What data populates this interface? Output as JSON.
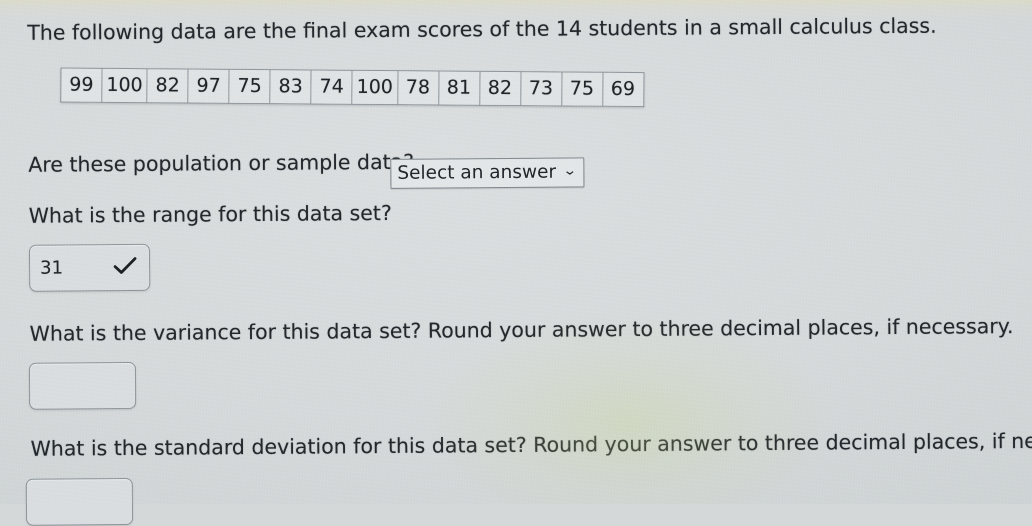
{
  "problem": {
    "intro": "The following data are the final exam scores of the 14 students in a small calculus class.",
    "scores": [
      99,
      100,
      82,
      97,
      75,
      83,
      74,
      100,
      78,
      81,
      82,
      73,
      75,
      69
    ],
    "student_count": 14
  },
  "questions": {
    "pop_or_sample": {
      "prompt": "Are these population or sample data?",
      "select_value": "Select an answer",
      "chevron": "chevron-down-icon"
    },
    "range": {
      "prompt": "What is the range for this data set?",
      "answer_value": "31",
      "status": "correct",
      "check_icon": "check-icon"
    },
    "variance": {
      "prompt": "What is the variance for this data set? Round your answer to three decimal places, if necessary.",
      "answer_value": ""
    },
    "stddev": {
      "prompt": "What is the standard deviation for this data set? Round your answer to three decimal places, if necessary.",
      "answer_value": ""
    }
  },
  "colors": {
    "background": "#d4d8d9",
    "text": "#22272b",
    "cell_fill": "#dfe3e4",
    "border": "#8f979c",
    "check": "#1b2024"
  }
}
